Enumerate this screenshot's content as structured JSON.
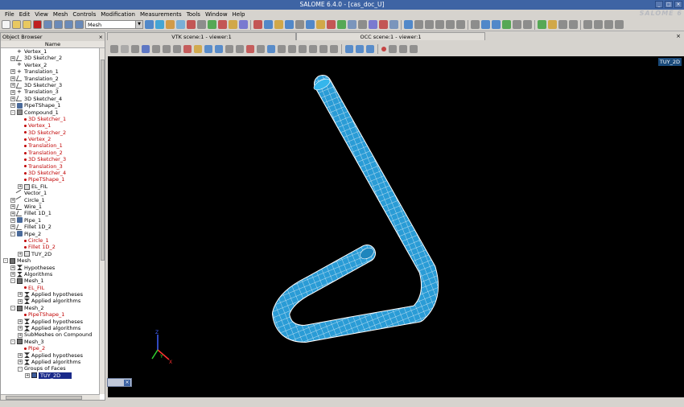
{
  "window": {
    "title": "SALOME 6.4.0 - [cas_doc_U]"
  },
  "brand": "SALOME 6",
  "menu": [
    "File",
    "Edit",
    "View",
    "Mesh",
    "Controls",
    "Modification",
    "Measurements",
    "Tools",
    "Window",
    "Help"
  ],
  "toolbar": {
    "module_combo": "Mesh"
  },
  "object_browser": {
    "title": "Object Browser",
    "column": "Name",
    "rows": [
      {
        "label": "Vertex_1",
        "indent": 1,
        "exp": "none",
        "icon": "plus",
        "red": false
      },
      {
        "label": "3D Sketcher_2",
        "indent": 1,
        "exp": "+",
        "icon": "sketch",
        "red": false
      },
      {
        "label": "Vertex_2",
        "indent": 1,
        "exp": "none",
        "icon": "plus",
        "red": false
      },
      {
        "label": "Translation_1",
        "indent": 1,
        "exp": "+",
        "icon": "plus",
        "red": false
      },
      {
        "label": "Translation_2",
        "indent": 1,
        "exp": "+",
        "icon": "sketch",
        "red": false
      },
      {
        "label": "3D Sketcher_3",
        "indent": 1,
        "exp": "+",
        "icon": "sketch",
        "red": false
      },
      {
        "label": "Translation_3",
        "indent": 1,
        "exp": "+",
        "icon": "plus",
        "red": false
      },
      {
        "label": "3D Sketcher_4",
        "indent": 1,
        "exp": "+",
        "icon": "sketch",
        "red": false
      },
      {
        "label": "PipeTShape_1",
        "indent": 1,
        "exp": "+",
        "icon": "pipe",
        "red": false
      },
      {
        "label": "Compound_1",
        "indent": 1,
        "exp": "-",
        "icon": "compound",
        "red": false
      },
      {
        "label": "3D Sketcher_1",
        "indent": 2,
        "exp": "none",
        "icon": "dot",
        "red": true
      },
      {
        "label": "Vertex_1",
        "indent": 2,
        "exp": "none",
        "icon": "dot",
        "red": true
      },
      {
        "label": "3D Sketcher_2",
        "indent": 2,
        "exp": "none",
        "icon": "dot",
        "red": true
      },
      {
        "label": "Vertex_2",
        "indent": 2,
        "exp": "none",
        "icon": "dot",
        "red": true
      },
      {
        "label": "Translation_1",
        "indent": 2,
        "exp": "none",
        "icon": "dot",
        "red": true
      },
      {
        "label": "Translation_2",
        "indent": 2,
        "exp": "none",
        "icon": "dot",
        "red": true
      },
      {
        "label": "3D Sketcher_3",
        "indent": 2,
        "exp": "none",
        "icon": "dot",
        "red": true
      },
      {
        "label": "Translation_3",
        "indent": 2,
        "exp": "none",
        "icon": "dot",
        "red": true
      },
      {
        "label": "3D Sketcher_4",
        "indent": 2,
        "exp": "none",
        "icon": "dot",
        "red": true
      },
      {
        "label": "PipeTShape_1",
        "indent": 2,
        "exp": "none",
        "icon": "dot",
        "red": true
      },
      {
        "label": "EL_FIL",
        "indent": 2,
        "exp": "+",
        "icon": "group",
        "red": false
      },
      {
        "label": "Vector_1",
        "indent": 1,
        "exp": "none",
        "icon": "line",
        "red": false
      },
      {
        "label": "Circle_1",
        "indent": 1,
        "exp": "+",
        "icon": "line",
        "red": false
      },
      {
        "label": "Wire_1",
        "indent": 1,
        "exp": "+",
        "icon": "sketch",
        "red": false
      },
      {
        "label": "Fillet 1D_1",
        "indent": 1,
        "exp": "+",
        "icon": "sketch",
        "red": false
      },
      {
        "label": "Pipe_1",
        "indent": 1,
        "exp": "+",
        "icon": "pipe",
        "red": false
      },
      {
        "label": "Fillet 1D_2",
        "indent": 1,
        "exp": "+",
        "icon": "sketch",
        "red": false
      },
      {
        "label": "Pipe_2",
        "indent": 1,
        "exp": "-",
        "icon": "pipe",
        "red": false
      },
      {
        "label": "Circle_1",
        "indent": 2,
        "exp": "none",
        "icon": "dot",
        "red": true
      },
      {
        "label": "Fillet 1D_2",
        "indent": 2,
        "exp": "none",
        "icon": "dot",
        "red": true
      },
      {
        "label": "TUY_2D",
        "indent": 2,
        "exp": "+",
        "icon": "group",
        "red": false
      },
      {
        "label": "Mesh",
        "indent": 0,
        "exp": "-",
        "icon": "mesh",
        "red": false
      },
      {
        "label": "Hypotheses",
        "indent": 1,
        "exp": "+",
        "icon": "hyp",
        "red": false
      },
      {
        "label": "Algorithms",
        "indent": 1,
        "exp": "+",
        "icon": "hyp",
        "red": false
      },
      {
        "label": "Mesh_1",
        "indent": 1,
        "exp": "-",
        "icon": "mesh",
        "red": false
      },
      {
        "label": "EL_FIL",
        "indent": 2,
        "exp": "none",
        "icon": "dot",
        "red": true
      },
      {
        "label": "Applied hypotheses",
        "indent": 2,
        "exp": "+",
        "icon": "hyp",
        "red": false
      },
      {
        "label": "Applied algorithms",
        "indent": 2,
        "exp": "+",
        "icon": "hyp",
        "red": false
      },
      {
        "label": "Mesh_2",
        "indent": 1,
        "exp": "-",
        "icon": "mesh",
        "red": false
      },
      {
        "label": "PipeTShape_1",
        "indent": 2,
        "exp": "none",
        "icon": "dot",
        "red": true
      },
      {
        "label": "Applied hypotheses",
        "indent": 2,
        "exp": "+",
        "icon": "hyp",
        "red": false
      },
      {
        "label": "Applied algorithms",
        "indent": 2,
        "exp": "+",
        "icon": "hyp",
        "red": false
      },
      {
        "label": "SubMeshes on Compound",
        "indent": 2,
        "exp": "+",
        "icon": "none",
        "red": false
      },
      {
        "label": "Mesh_3",
        "indent": 1,
        "exp": "-",
        "icon": "mesh",
        "red": false
      },
      {
        "label": "Pipe_2",
        "indent": 2,
        "exp": "none",
        "icon": "dot",
        "red": true
      },
      {
        "label": "Applied hypotheses",
        "indent": 2,
        "exp": "+",
        "icon": "hyp",
        "red": false
      },
      {
        "label": "Applied algorithms",
        "indent": 2,
        "exp": "+",
        "icon": "hyp",
        "red": false
      },
      {
        "label": "Groups of Faces",
        "indent": 2,
        "exp": "-",
        "icon": "none",
        "red": false
      },
      {
        "label": "TUY_2D",
        "indent": 3,
        "exp": "+",
        "icon": "face",
        "red": false,
        "selected": true
      }
    ]
  },
  "tabs": [
    {
      "label": "VTK scene:1 - viewer:1",
      "active": true
    },
    {
      "label": "OCC scene:1 - viewer:1",
      "active": false
    }
  ],
  "viewport": {
    "badge": "TUY_2D",
    "mesh_color": "#2a9cd6"
  },
  "axes": {
    "x": "X",
    "y": "Y",
    "z": "Z"
  }
}
